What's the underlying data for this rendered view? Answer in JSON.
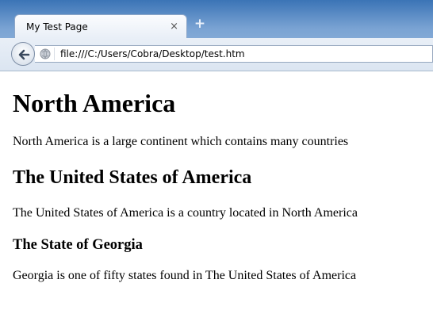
{
  "browser": {
    "tab": {
      "title": "My Test Page",
      "close_glyph": "×"
    },
    "new_tab_glyph": "+",
    "address": "file:///C:/Users/Cobra/Desktop/test.htm",
    "icons": {
      "back": "back-arrow-icon",
      "site": "globe-icon"
    }
  },
  "page": {
    "h1": "North America",
    "p1": "North America is a large continent which contains many countries",
    "h2": "The United States of America",
    "p2": "The United States of America is a country located in North America",
    "h3": "The State of Georgia",
    "p3": "Georgia is one of fifty states found in The United States of America"
  }
}
